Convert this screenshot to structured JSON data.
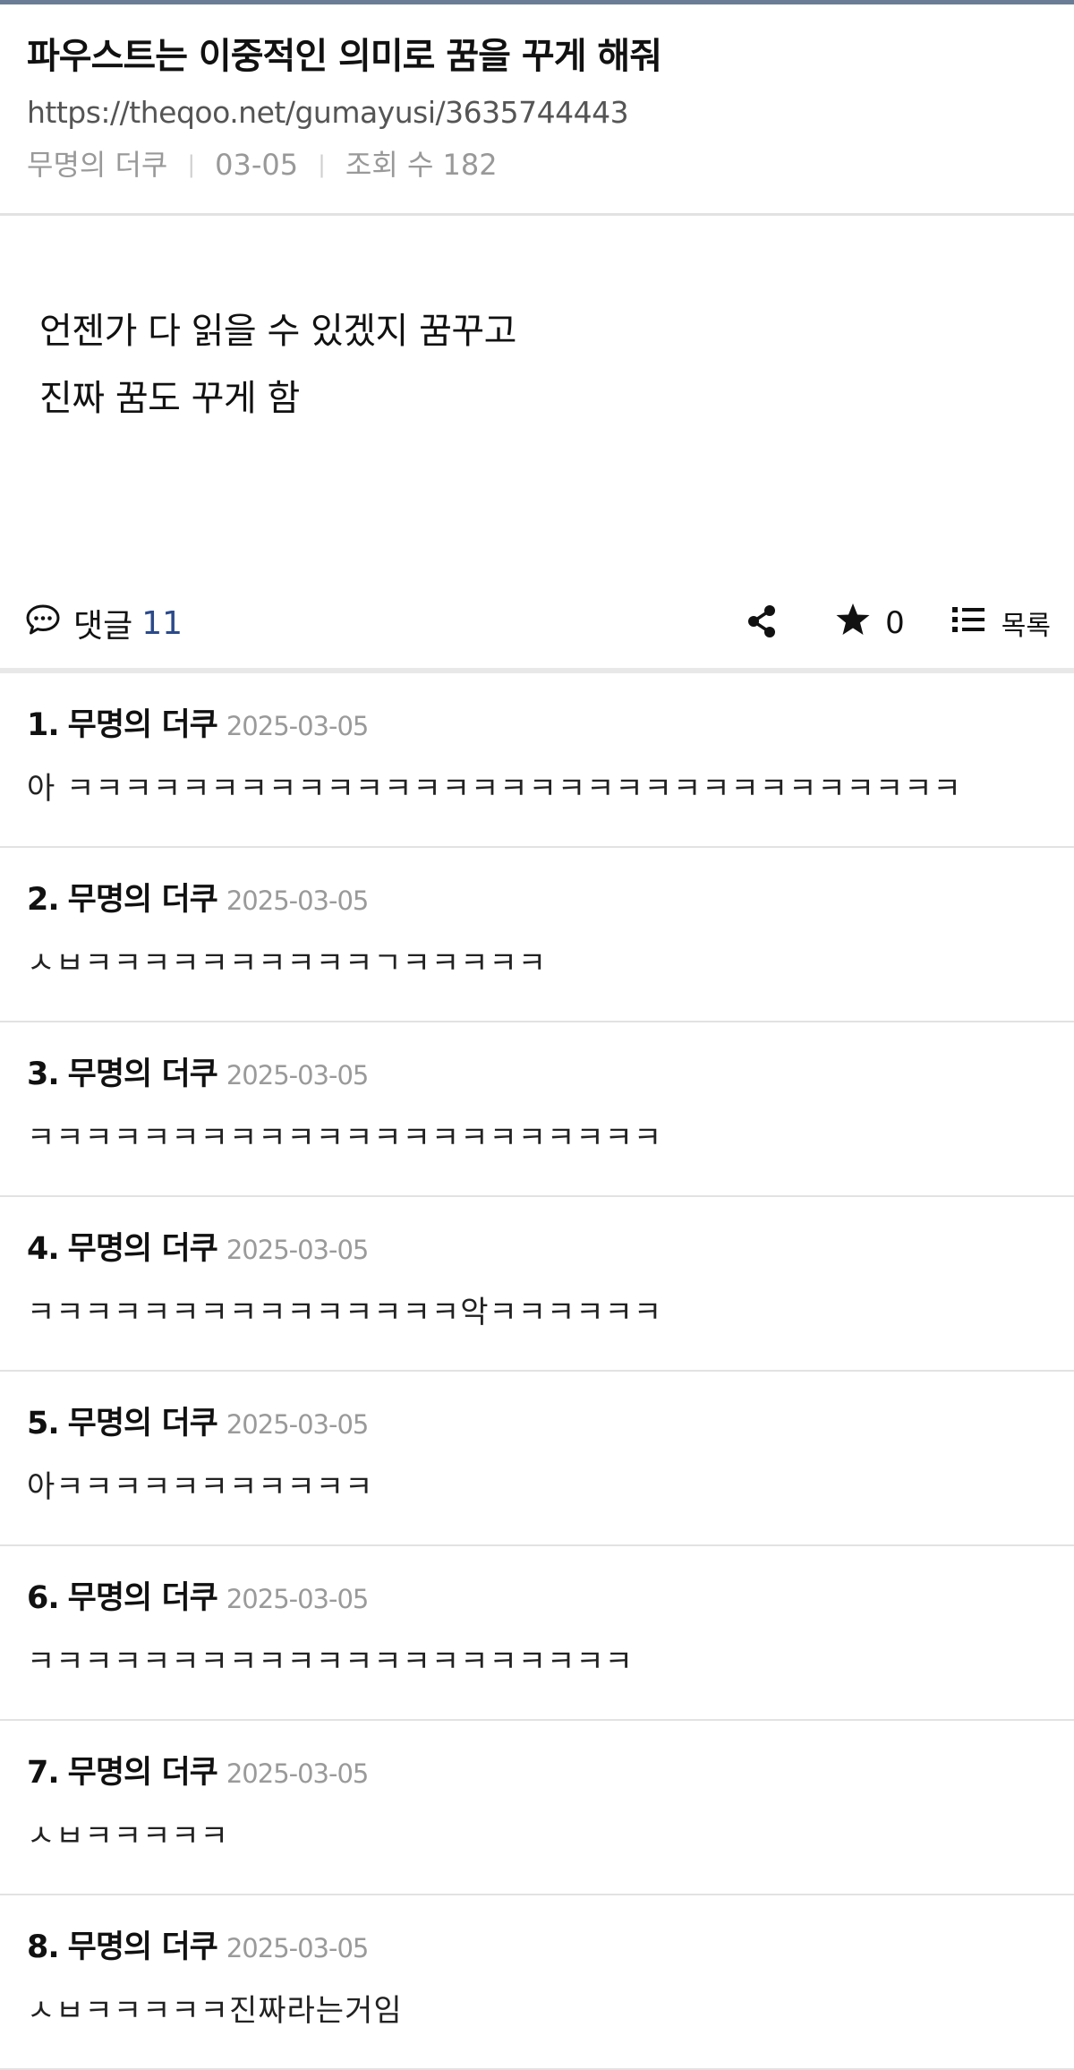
{
  "post": {
    "title": "파우스트는 이중적인 의미로 꿈을 꾸게 해줘",
    "url": "https://theqoo.net/gumayusi/3635744443",
    "author": "무명의 더쿠",
    "date": "03-05",
    "views_label": "조회 수 182",
    "body_lines": [
      "언젠가 다 읽을 수 있겠지 꿈꾸고",
      "진짜 꿈도 꾸게 함"
    ]
  },
  "actions": {
    "comment_label": "댓글",
    "comment_count": "11",
    "star_count": "0",
    "list_label": "목록",
    "icons": [
      "comment-icon",
      "share-icon",
      "star-icon",
      "list-icon"
    ]
  },
  "comments": [
    {
      "num": "1.",
      "author": "무명의 더쿠",
      "date": "2025-03-05",
      "text": "아 ㅋㅋㅋㅋㅋㅋㅋㅋㅋㅋㅋㅋㅋㅋㅋㅋㅋㅋㅋㅋㅋㅋㅋㅋㅋㅋㅋㅋㅋㅋㅋ"
    },
    {
      "num": "2.",
      "author": "무명의 더쿠",
      "date": "2025-03-05",
      "text": "ㅅㅂㅋㅋㅋㅋㅋㅋㅋㅋㅋㅋㄱㅋㅋㅋㅋㅋ"
    },
    {
      "num": "3.",
      "author": "무명의 더쿠",
      "date": "2025-03-05",
      "text": "ㅋㅋㅋㅋㅋㅋㅋㅋㅋㅋㅋㅋㅋㅋㅋㅋㅋㅋㅋㅋㅋㅋ"
    },
    {
      "num": "4.",
      "author": "무명의 더쿠",
      "date": "2025-03-05",
      "text": "ㅋㅋㅋㅋㅋㅋㅋㅋㅋㅋㅋㅋㅋㅋㅋ악ㅋㅋㅋㅋㅋㅋ"
    },
    {
      "num": "5.",
      "author": "무명의 더쿠",
      "date": "2025-03-05",
      "text": "아ㅋㅋㅋㅋㅋㅋㅋㅋㅋㅋㅋ"
    },
    {
      "num": "6.",
      "author": "무명의 더쿠",
      "date": "2025-03-05",
      "text": "ㅋㅋㅋㅋㅋㅋㅋㅋㅋㅋㅋㅋㅋㅋㅋㅋㅋㅋㅋㅋㅋ"
    },
    {
      "num": "7.",
      "author": "무명의 더쿠",
      "date": "2025-03-05",
      "text": "ㅅㅂㅋㅋㅋㅋㅋ"
    },
    {
      "num": "8.",
      "author": "무명의 더쿠",
      "date": "2025-03-05",
      "text": "ㅅㅂㅋㅋㅋㅋㅋ진짜라는거임"
    }
  ],
  "colors": {
    "accent": "#2b4a8a",
    "top_bar": "#6b7d96",
    "muted_text": "#999999",
    "divider": "#e2e2e2"
  }
}
